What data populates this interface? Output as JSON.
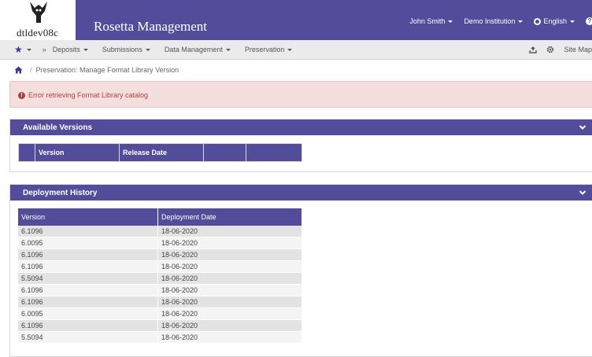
{
  "header": {
    "logo_text": "dtldev08c",
    "app_title": "Rosetta Management",
    "user": "John Smith",
    "institution": "Demo Institution",
    "language": "English"
  },
  "nav": {
    "items": [
      "Deposits",
      "Submissions",
      "Data Management",
      "Preservation"
    ],
    "separator": "»",
    "site_map": "Site Map"
  },
  "breadcrumb": {
    "page": "Preservation: Manage Format Library Version"
  },
  "alert": {
    "message": "Error retrieving Format Library catalog"
  },
  "available_versions": {
    "title": "Available Versions",
    "columns": [
      "",
      "Version",
      "Release Date",
      "",
      ""
    ]
  },
  "deployment_history": {
    "title": "Deployment History",
    "columns": [
      "Version",
      "Deployment Date"
    ],
    "rows": [
      [
        "6.1096",
        "18-06-2020"
      ],
      [
        "6.0095",
        "18-06-2020"
      ],
      [
        "6.1096",
        "18-06-2020"
      ],
      [
        "6.1096",
        "18-06-2020"
      ],
      [
        "5.5094",
        "18-06-2020"
      ],
      [
        "6.1096",
        "18-06-2020"
      ],
      [
        "6.1096",
        "18-06-2020"
      ],
      [
        "6.0095",
        "18-06-2020"
      ],
      [
        "6.1096",
        "18-06-2020"
      ],
      [
        "5.5094",
        "18-06-2020"
      ]
    ]
  },
  "colors": {
    "brand": "#524c9a",
    "alert_bg": "#f5dede",
    "alert_text": "#a94442",
    "row_alt": "#e3e3e3"
  },
  "icons": [
    "logo-icon",
    "caret-icon",
    "globe-icon",
    "help-icon",
    "star-icon",
    "upload-icon",
    "gear-icon",
    "home-icon",
    "error-icon",
    "chevron-down-icon"
  ]
}
